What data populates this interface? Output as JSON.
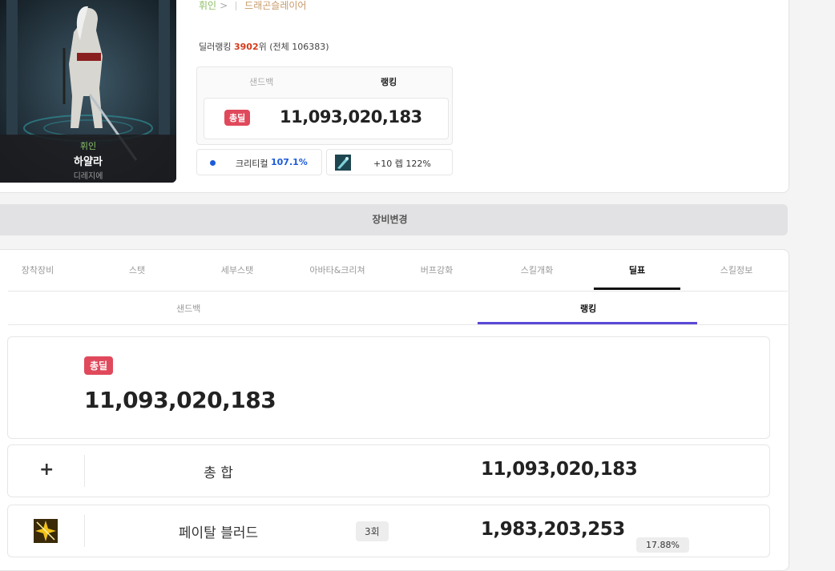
{
  "character": {
    "job": "휘인",
    "name": "하얄라",
    "server": "디레지에"
  },
  "breadcrumb": {
    "base_class": "휘인",
    "advancement": "드래곤슬레이어"
  },
  "ranking_line": {
    "prefix": "딜러랭킹",
    "rank": "3902",
    "suffix": "위 (전체 106383)"
  },
  "mini_tabs": [
    "샌드백",
    "랭킹"
  ],
  "total_damage": {
    "badge": "총딜",
    "value": "11,093,020,183"
  },
  "stats": {
    "crit_label": "크리티컬",
    "crit_value": "107.1%",
    "weapon_text": "+10 렙 122%"
  },
  "equip_change_label": "장비변경",
  "tabs": [
    "장착장비",
    "스탯",
    "세부스탯",
    "아바타&크리쳐",
    "버프강화",
    "스킬개화",
    "딜표",
    "스킬정보"
  ],
  "subtabs": [
    "샌드백",
    "랭킹"
  ],
  "rows": [
    {
      "icon": "plus-icon",
      "name": "총 합",
      "value": "11,093,020,183"
    },
    {
      "icon": "fatal-blood-skill-icon",
      "name": "페이탈 블러드",
      "count": "3회",
      "value": "1,983,203,253",
      "share": "17.88%"
    }
  ],
  "colors": {
    "badge_red": "#e0495b",
    "rank_red": "#d43a1b",
    "crit_blue": "#1d5ad8",
    "subtab_purple": "#5a48d6",
    "job_green": "#8bc56b"
  }
}
